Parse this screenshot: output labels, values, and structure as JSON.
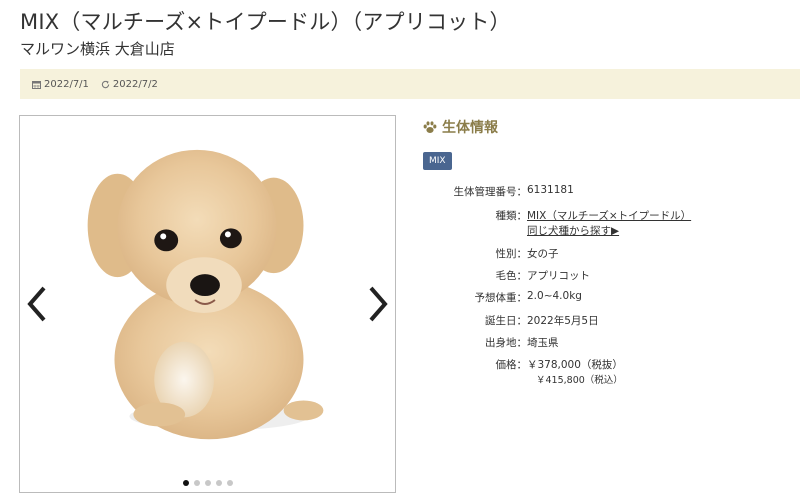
{
  "header": {
    "title": "MIX（マルチーズ×トイプードル）（アプリコット）",
    "store": "マルワン横浜 大倉山店"
  },
  "dates": {
    "posted": "2022/7/1",
    "updated": "2022/7/2"
  },
  "gallery": {
    "slide_count": 5,
    "active_index": 0
  },
  "info": {
    "heading": "生体情報",
    "tag": "MIX",
    "rows": {
      "id": {
        "label": "生体管理番号：",
        "value": "6131181"
      },
      "breed": {
        "label": "種類：",
        "value": "MIX（マルチーズ×トイプードル）",
        "link": "同じ犬種から探す▶"
      },
      "sex": {
        "label": "性別：",
        "value": "女の子"
      },
      "color": {
        "label": "毛色：",
        "value": "アプリコット"
      },
      "weight": {
        "label": "予想体重：",
        "value": "2.0~4.0kg"
      },
      "birthday": {
        "label": "誕生日：",
        "value": "2022年5月5日"
      },
      "origin": {
        "label": "出身地：",
        "value": "埼玉県"
      },
      "price": {
        "label": "価格：",
        "value": "￥378,000（税抜）",
        "value_tax": "￥415,800（税込）"
      }
    }
  },
  "colors": {
    "accent": "#8b7d4a",
    "tag_bg": "#4a6690",
    "date_bar_bg": "#f6f2dc"
  },
  "icons": {
    "calendar": "calendar-icon",
    "refresh": "refresh-icon",
    "paw": "paw-icon",
    "prev": "chevron-left-icon",
    "next": "chevron-right-icon"
  }
}
